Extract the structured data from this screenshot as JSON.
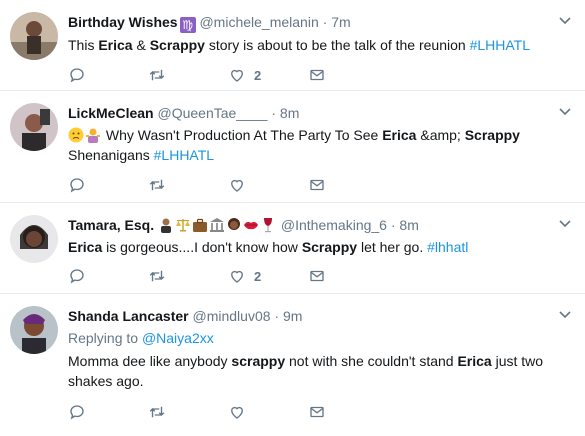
{
  "tweets": [
    {
      "name": "Birthday Wishes",
      "badge": "♍",
      "handle": "@michele_melanin",
      "dot": "·",
      "time": "7m",
      "text_parts": [
        "This ",
        "Erica",
        " & ",
        "Scrappy",
        " story is about to be the talk of the reunion ",
        "#LHHATL"
      ],
      "likes": "2"
    },
    {
      "name": "LickMeClean",
      "handle": "@QueenTae____",
      "dot": "·",
      "time": "8m",
      "text_parts": [
        "Why Wasn't Production At The Party To See ",
        "Erica",
        " &amp; ",
        "Scrappy",
        " Shenanigans  ",
        "#LHHATL"
      ]
    },
    {
      "name": "Tamara, Esq.",
      "handle": "@Inthemaking_6",
      "dot": "·",
      "time": "8m",
      "text_parts": [
        "Erica",
        " is gorgeous....I don't know how ",
        "Scrappy",
        " let her go. ",
        "#lhhatl"
      ],
      "likes": "2"
    },
    {
      "name": "Shanda Lancaster",
      "handle": "@mindluv08",
      "dot": "·",
      "time": "9m",
      "replying_label": "Replying to ",
      "replying_to": "@Naiya2xx",
      "text_parts": [
        "Momma dee like anybody ",
        "scrappy",
        " not with she couldn't stand ",
        "Erica",
        " just two shakes ago."
      ]
    }
  ],
  "icons": {
    "reply": "reply-icon",
    "retweet": "retweet-icon",
    "like": "heart-icon",
    "dm": "envelope-icon",
    "more": "chevron-down-icon"
  },
  "colors": {
    "link": "#1b95e0",
    "secondary": "#657786",
    "text": "#14171a"
  }
}
